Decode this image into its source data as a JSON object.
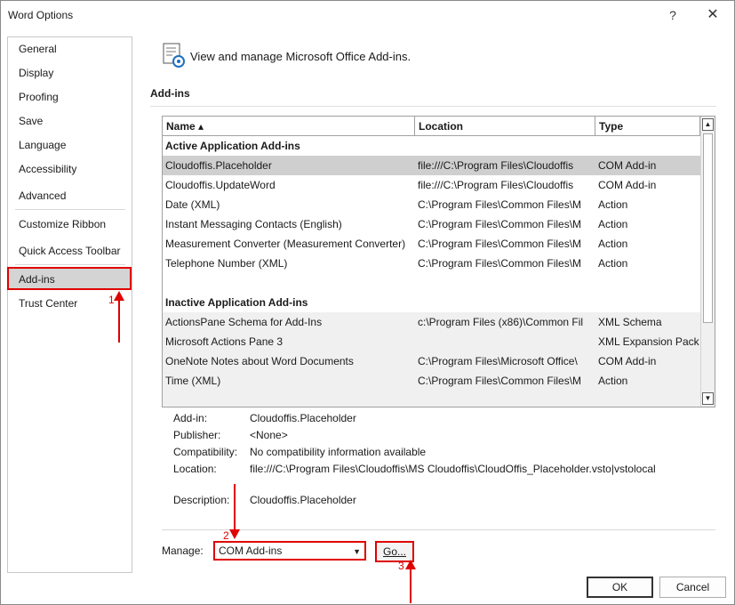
{
  "window": {
    "title": "Word Options",
    "help_label": "?",
    "close_label": "✕"
  },
  "sidebar": {
    "items": [
      {
        "label": "General"
      },
      {
        "label": "Display"
      },
      {
        "label": "Proofing"
      },
      {
        "label": "Save"
      },
      {
        "label": "Language"
      },
      {
        "label": "Accessibility"
      },
      {
        "label": "Advanced"
      },
      {
        "label": "Customize Ribbon"
      },
      {
        "label": "Quick Access Toolbar"
      },
      {
        "label": "Add-ins",
        "selected": true
      },
      {
        "label": "Trust Center"
      }
    ]
  },
  "main": {
    "header_icon": "addins-gear-icon",
    "header_text": "View and manage Microsoft Office Add-ins.",
    "section_title": "Add-ins",
    "table": {
      "columns": [
        "Name ▴",
        "Location",
        "Type"
      ],
      "active_group": "Active Application Add-ins",
      "active_rows": [
        {
          "name": "Cloudoffis.Placeholder",
          "location": "file:///C:\\Program Files\\Cloudoffis",
          "type": "COM Add-in",
          "selected": true
        },
        {
          "name": "Cloudoffis.UpdateWord",
          "location": "file:///C:\\Program Files\\Cloudoffis",
          "type": "COM Add-in"
        },
        {
          "name": "Date (XML)",
          "location": "C:\\Program Files\\Common Files\\M",
          "type": "Action"
        },
        {
          "name": "Instant Messaging Contacts (English)",
          "location": "C:\\Program Files\\Common Files\\M",
          "type": "Action"
        },
        {
          "name": "Measurement Converter (Measurement Converter)",
          "location": "C:\\Program Files\\Common Files\\M",
          "type": "Action"
        },
        {
          "name": "Telephone Number (XML)",
          "location": "C:\\Program Files\\Common Files\\M",
          "type": "Action"
        }
      ],
      "inactive_group": "Inactive Application Add-ins",
      "inactive_rows": [
        {
          "name": "ActionsPane Schema for Add-Ins",
          "location": "c:\\Program Files (x86)\\Common Fil",
          "type": "XML Schema"
        },
        {
          "name": "Microsoft Actions Pane 3",
          "location": "",
          "type": "XML Expansion Pack"
        },
        {
          "name": "OneNote Notes about Word Documents",
          "location": "C:\\Program Files\\Microsoft Office\\",
          "type": "COM Add-in"
        },
        {
          "name": "Time (XML)",
          "location": "C:\\Program Files\\Common Files\\M",
          "type": "Action"
        }
      ]
    },
    "details": {
      "addin_label": "Add-in:",
      "addin_value": "Cloudoffis.Placeholder",
      "publisher_label": "Publisher:",
      "publisher_value": "<None>",
      "compat_label": "Compatibility:",
      "compat_value": "No compatibility information available",
      "location_label": "Location:",
      "location_value": "file:///C:\\Program Files\\Cloudoffis\\MS Cloudoffis\\CloudOffis_Placeholder.vsto|vstolocal",
      "description_label": "Description:",
      "description_value": "Cloudoffis.Placeholder"
    },
    "manage": {
      "label": "Manage:",
      "selected": "COM Add-ins",
      "go_label": "Go..."
    }
  },
  "footer": {
    "ok_label": "OK",
    "cancel_label": "Cancel"
  },
  "annotations": {
    "n1": "1",
    "n2": "2",
    "n3": "3",
    "color": "#e00000"
  }
}
